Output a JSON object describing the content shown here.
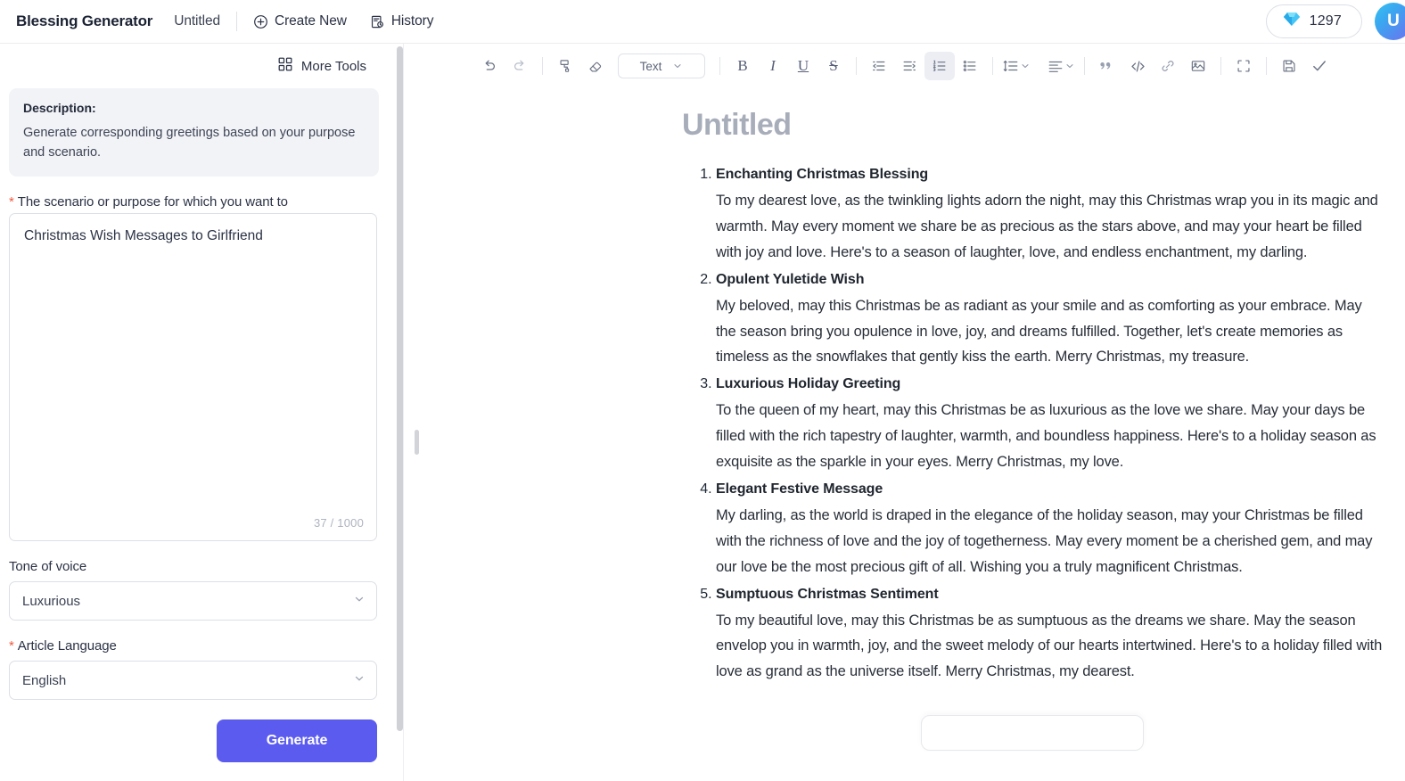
{
  "topbar": {
    "app_title": "Blessing Generator",
    "doc_name": "Untitled",
    "create_new_label": "Create New",
    "history_label": "History",
    "credits_value": "1297",
    "avatar_initial": "U"
  },
  "left_panel": {
    "more_tools_label": "More Tools",
    "description_title": "Description:",
    "description_text": "Generate corresponding greetings based on your purpose and scenario.",
    "scenario_label": "The scenario or purpose for which you want to",
    "scenario_value": "Christmas Wish Messages to Girlfriend",
    "scenario_counter": "37 / 1000",
    "tone_label": "Tone of voice",
    "tone_value": "Luxurious",
    "language_label": "Article Language",
    "language_value": "English",
    "generate_label": "Generate"
  },
  "toolbar": {
    "block_type": "Text",
    "bold": "B",
    "italic": "I",
    "underline": "U",
    "strike": "S"
  },
  "document": {
    "title": "Untitled",
    "items": [
      {
        "heading": "Enchanting Christmas Blessing",
        "body": "To my dearest love, as the twinkling lights adorn the night, may this Christmas wrap you in its magic and warmth. May every moment we share be as precious as the stars above, and may your heart be filled with joy and love. Here's to a season of laughter, love, and endless enchantment, my darling."
      },
      {
        "heading": "Opulent Yuletide Wish",
        "body": "My beloved, may this Christmas be as radiant as your smile and as comforting as your embrace. May the season bring you opulence in love, joy, and dreams fulfilled. Together, let's create memories as timeless as the snowflakes that gently kiss the earth. Merry Christmas, my treasure."
      },
      {
        "heading": "Luxurious Holiday Greeting",
        "body": "To the queen of my heart, may this Christmas be as luxurious as the love we share. May your days be filled with the rich tapestry of laughter, warmth, and boundless happiness. Here's to a holiday season as exquisite as the sparkle in your eyes. Merry Christmas, my love."
      },
      {
        "heading": "Elegant Festive Message",
        "body": "My darling, as the world is draped in the elegance of the holiday season, may your Christmas be filled with the richness of love and the joy of togetherness. May every moment be a cherished gem, and may our love be the most precious gift of all. Wishing you a truly magnificent Christmas."
      },
      {
        "heading": "Sumptuous Christmas Sentiment",
        "body": "To my beautiful love, may this Christmas be as sumptuous as the dreams we share. May the season envelop you in warmth, joy, and the sweet melody of our hearts intertwined. Here's to a holiday filled with love as grand as the universe itself. Merry Christmas, my dearest."
      }
    ]
  },
  "colors": {
    "accent": "#5b5bf0",
    "required": "#f05a3c",
    "title_gray": "#a8adba",
    "panel_bg": "#f2f3f7"
  }
}
